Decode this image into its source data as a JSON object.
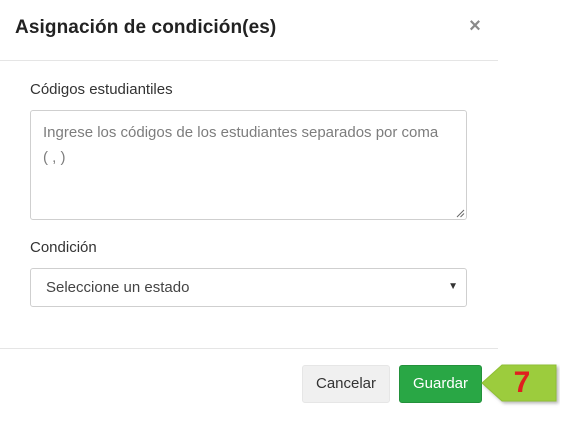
{
  "modal": {
    "title": "Asignación de condición(es)",
    "close_symbol": "×"
  },
  "form": {
    "codes_label": "Códigos estudiantiles",
    "codes_placeholder": "Ingrese los códigos de los estudiantes separados por coma ( , )",
    "codes_value": "",
    "condition_label": "Condición",
    "condition_selected": "Seleccione un estado"
  },
  "footer": {
    "cancel_label": "Cancelar",
    "save_label": "Guardar"
  },
  "callout": {
    "step_number": "7"
  },
  "colors": {
    "save_button": "#29a745",
    "callout_fill": "#9ccc3c",
    "step_number": "#e01f1f"
  },
  "icons": {
    "close": "close-icon",
    "select_caret": "caret-down-icon",
    "resize": "resize-grip-icon"
  }
}
